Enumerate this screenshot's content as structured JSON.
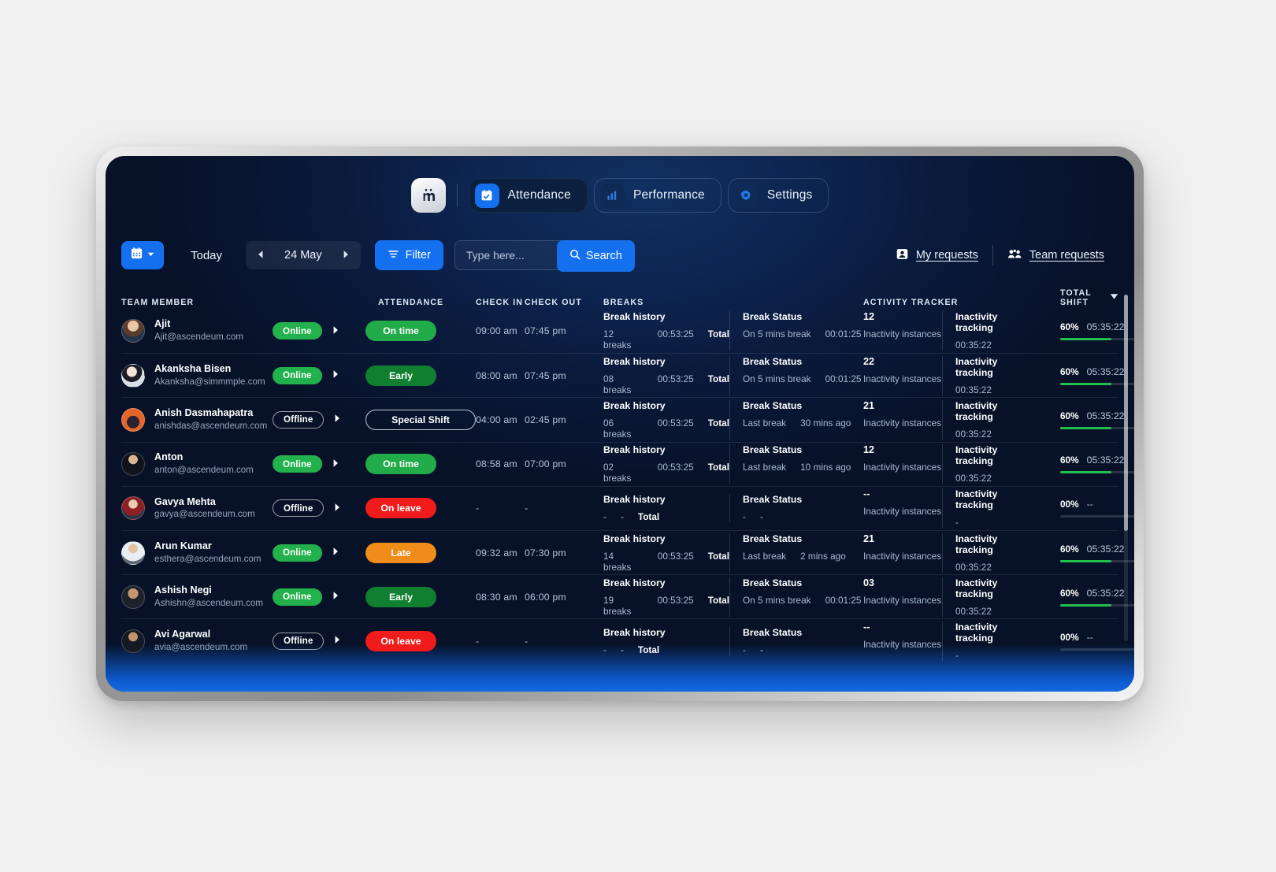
{
  "nav": {
    "logo": "m",
    "logo_icon": "app-logo-icon",
    "items": [
      {
        "label": "Attendance",
        "icon": "calendar-check-icon",
        "active": true
      },
      {
        "label": "Performance",
        "icon": "bar-chart-icon",
        "active": false
      },
      {
        "label": "Settings",
        "icon": "gear-icon",
        "active": false
      }
    ]
  },
  "toolbar": {
    "calendar_icon": "calendar-icon",
    "calendar_caret": "chevron-down-icon",
    "today_label": "Today",
    "prev_icon": "chevron-left-icon",
    "date_label": "24 May",
    "next_icon": "chevron-right-icon",
    "filter_label": "Filter",
    "filter_icon": "filter-icon",
    "search_placeholder": "Type here...",
    "search_value": "",
    "search_label": "Search",
    "search_icon": "search-icon",
    "my_requests": "My requests",
    "my_requests_icon": "person-card-icon",
    "team_requests": "Team requests",
    "team_requests_icon": "people-icon"
  },
  "table": {
    "headers": {
      "member": "TEAM MEMBER",
      "attendance": "ATTENDANCE",
      "check_in": "CHECK IN",
      "check_out": "CHECK OUT",
      "breaks": "BREAKS",
      "activity": "ACTIVITY TRACKER",
      "total_shift": "TOTAL SHIFT",
      "total_shift_caret": "chevron-down-icon"
    },
    "labels": {
      "break_history": "Break history",
      "break_status": "Break Status",
      "total": "Total",
      "inactivity_instances": "Inactivity instances",
      "inactivity_tracking": "Inactivity tracking"
    },
    "rows": [
      {
        "name": "Ajit",
        "email": "Ajit@ascendeum.com",
        "status": "Online",
        "status_type": "online",
        "attendance": "On time",
        "attendance_type": "ontime",
        "check_in": "09:00 am",
        "check_out": "07:45 pm",
        "breaks_count": "12 breaks",
        "breaks_total": "00:53:25",
        "break_status": "On 5 mins break",
        "break_status_time": "00:01:25",
        "inactivity_count": "12",
        "inactivity_time": "00:35:22",
        "shift_pct": "60%",
        "shift_time": "05:35:22",
        "shift_fill": 60
      },
      {
        "name": "Akanksha Bisen",
        "email": "Akanksha@simmmple.com",
        "status": "Online",
        "status_type": "online",
        "attendance": "Early",
        "attendance_type": "early",
        "check_in": "08:00 am",
        "check_out": "07:45 pm",
        "breaks_count": "08 breaks",
        "breaks_total": "00:53:25",
        "break_status": "On 5 mins break",
        "break_status_time": "00:01:25",
        "inactivity_count": "22",
        "inactivity_time": "00:35:22",
        "shift_pct": "60%",
        "shift_time": "05:35:22",
        "shift_fill": 60
      },
      {
        "name": "Anish Dasmahapatra",
        "email": "anishdas@ascendeum.com",
        "status": "Offline",
        "status_type": "offline",
        "attendance": "Special Shift",
        "attendance_type": "special",
        "check_in": "04:00 am",
        "check_out": "02:45 pm",
        "breaks_count": "06 breaks",
        "breaks_total": "00:53:25",
        "break_status": "Last break",
        "break_status_time": "30 mins ago",
        "inactivity_count": "21",
        "inactivity_time": "00:35:22",
        "shift_pct": "60%",
        "shift_time": "05:35:22",
        "shift_fill": 60
      },
      {
        "name": "Anton",
        "email": "anton@ascendeum.com",
        "status": "Online",
        "status_type": "online",
        "attendance": "On time",
        "attendance_type": "ontime",
        "check_in": "08:58 am",
        "check_out": "07:00 pm",
        "breaks_count": "02 breaks",
        "breaks_total": "00:53:25",
        "break_status": "Last break",
        "break_status_time": "10 mins ago",
        "inactivity_count": "12",
        "inactivity_time": "00:35:22",
        "shift_pct": "60%",
        "shift_time": "05:35:22",
        "shift_fill": 60
      },
      {
        "name": "Gavya Mehta",
        "email": "gavya@ascendeum.com",
        "status": "Offline",
        "status_type": "offline",
        "attendance": "On leave",
        "attendance_type": "leave",
        "check_in": "-",
        "check_out": "-",
        "breaks_count": "-",
        "breaks_total": "-",
        "break_status": "-",
        "break_status_time": "-",
        "inactivity_count": "--",
        "inactivity_time": "-",
        "shift_pct": "00%",
        "shift_time": "--",
        "shift_fill": 0
      },
      {
        "name": "Arun Kumar",
        "email": "esthera@ascendeum.com",
        "status": "Online",
        "status_type": "online",
        "attendance": "Late",
        "attendance_type": "late",
        "check_in": "09:32 am",
        "check_out": "07:30 pm",
        "breaks_count": "14 breaks",
        "breaks_total": "00:53:25",
        "break_status": "Last break",
        "break_status_time": "2 mins ago",
        "inactivity_count": "21",
        "inactivity_time": "00:35:22",
        "shift_pct": "60%",
        "shift_time": "05:35:22",
        "shift_fill": 60
      },
      {
        "name": "Ashish Negi",
        "email": "Ashishn@ascendeum.com",
        "status": "Online",
        "status_type": "online",
        "attendance": "Early",
        "attendance_type": "early",
        "check_in": "08:30 am",
        "check_out": "06:00 pm",
        "breaks_count": "19 breaks",
        "breaks_total": "00:53:25",
        "break_status": "On 5 mins break",
        "break_status_time": "00:01:25",
        "inactivity_count": "03",
        "inactivity_time": "00:35:22",
        "shift_pct": "60%",
        "shift_time": "05:35:22",
        "shift_fill": 60
      },
      {
        "name": "Avi Agarwal",
        "email": "avia@ascendeum.com",
        "status": "Offline",
        "status_type": "offline",
        "attendance": "On leave",
        "attendance_type": "leave",
        "check_in": "-",
        "check_out": "-",
        "breaks_count": "-",
        "breaks_total": "-",
        "break_status": "-",
        "break_status_time": "-",
        "inactivity_count": "--",
        "inactivity_time": "-",
        "shift_pct": "00%",
        "shift_time": "--",
        "shift_fill": 0
      }
    ]
  },
  "colors": {
    "accent_blue": "#1570ef",
    "online_green": "#22b14c",
    "early_green": "#108030",
    "late_orange": "#f08c1a",
    "leave_red": "#f01b1b",
    "progress_green": "#21c04d"
  }
}
